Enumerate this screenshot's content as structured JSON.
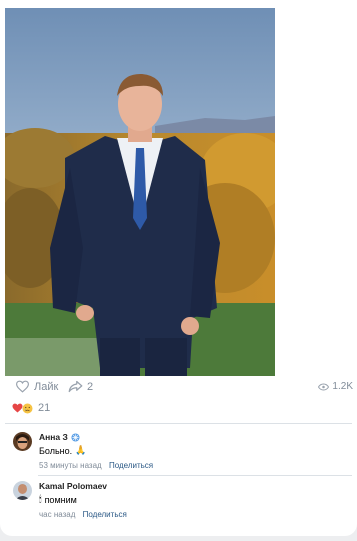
{
  "post": {
    "actions": {
      "like_label": "Лайк",
      "share_count": "2",
      "views_count": "1.2K"
    },
    "reactions": {
      "emojis": [
        "heart-emoji",
        "crying-emoji"
      ],
      "count": "21"
    }
  },
  "comments": [
    {
      "author": "Анна З",
      "badge_icon": "snowflake-badge-icon",
      "text": "Больно.",
      "text_emoji": "🙏",
      "time": "53 минуты назад",
      "reply_label": "Поделиться"
    },
    {
      "author": "Kamal Polomaev",
      "text_emoji": "🕯",
      "text": "помним",
      "time": "час назад",
      "reply_label": "Поделиться"
    }
  ],
  "colors": {
    "accent": "#2a5885",
    "muted": "#818c99",
    "heart": "#e64646"
  }
}
